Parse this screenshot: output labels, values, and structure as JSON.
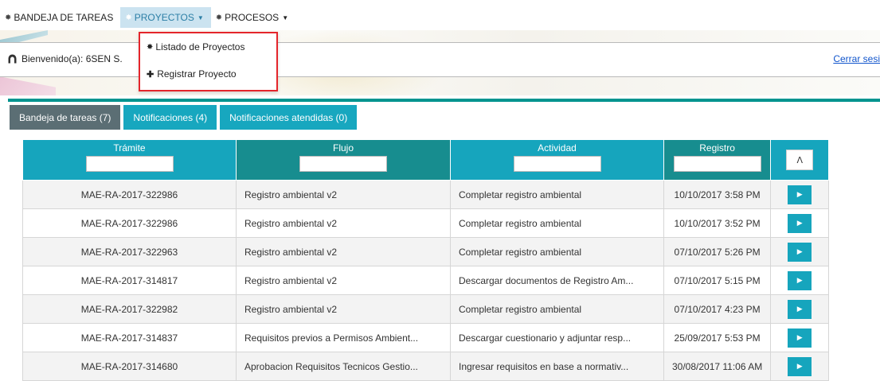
{
  "nav": {
    "items": [
      {
        "label": "BANDEJA DE TAREAS",
        "caret": false
      },
      {
        "label": "PROYECTOS",
        "caret": true
      },
      {
        "label": "PROCESOS",
        "caret": true
      }
    ]
  },
  "dropdown": {
    "items": [
      {
        "label": "Listado de Proyectos",
        "icon": "gear-icon"
      },
      {
        "label": "Registrar Proyecto",
        "icon": "plus-icon"
      }
    ]
  },
  "header": {
    "welcome": "Bienvenido(a): 6SEN S.",
    "logout": "Cerrar sesi"
  },
  "tabs": [
    {
      "label": "Bandeja de tareas (7)"
    },
    {
      "label": "Notificaciones (4)"
    },
    {
      "label": "Notificaciones atendidas (0)"
    }
  ],
  "table": {
    "columns": [
      "Trámite",
      "Flujo",
      "Actividad",
      "Registro"
    ],
    "refresh_icon": "refresh-icon",
    "rows": [
      [
        "MAE-RA-2017-322986",
        "Registro ambiental v2",
        "Completar registro ambiental",
        "10/10/2017 3:58 PM"
      ],
      [
        "MAE-RA-2017-322986",
        "Registro ambiental v2",
        "Completar registro ambiental",
        "10/10/2017 3:52 PM"
      ],
      [
        "MAE-RA-2017-322963",
        "Registro ambiental v2",
        "Completar registro ambiental",
        "07/10/2017 5:26 PM"
      ],
      [
        "MAE-RA-2017-314817",
        "Registro ambiental v2",
        "Descargar documentos de Registro Am...",
        "07/10/2017 5:15 PM"
      ],
      [
        "MAE-RA-2017-322982",
        "Registro ambiental v2",
        "Completar registro ambiental",
        "07/10/2017 4:23 PM"
      ],
      [
        "MAE-RA-2017-314837",
        "Requisitos previos a Permisos Ambient...",
        "Descargar cuestionario y adjuntar resp...",
        "25/09/2017 5:53 PM"
      ],
      [
        "MAE-RA-2017-314680",
        "Aprobacion Requisitos Tecnicos Gestio...",
        "Ingresar requisitos en base a normativ...",
        "30/08/2017 11:06 AM"
      ]
    ]
  },
  "colors": {
    "teal": "#16a5bd",
    "dark_teal": "#178d8f",
    "highlight": "#e4252b"
  }
}
